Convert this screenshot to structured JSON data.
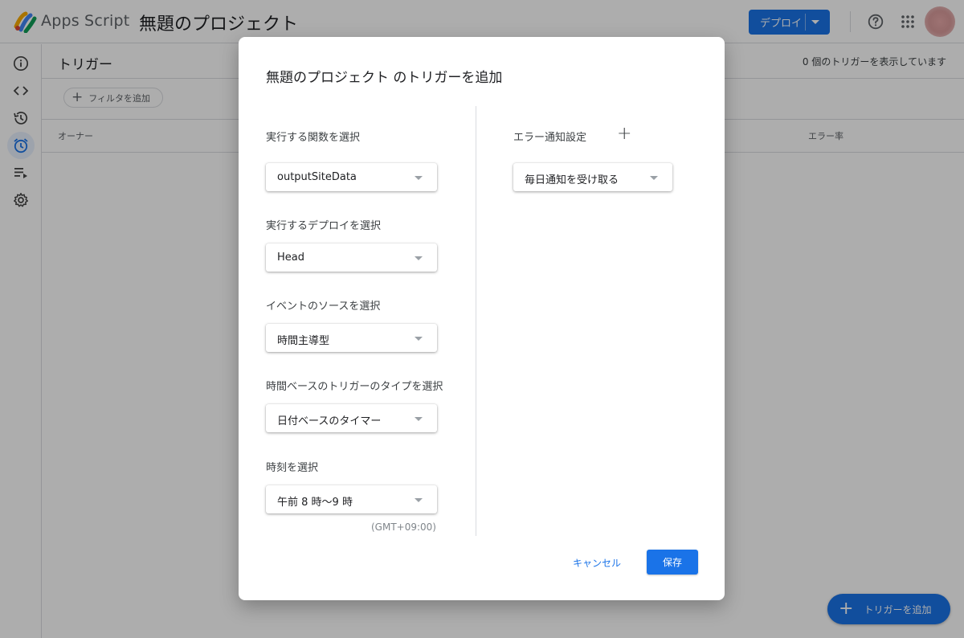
{
  "header": {
    "app_name": "Apps Script",
    "project_name": "無題のプロジェクト",
    "deploy_label": "デプロイ",
    "icons": [
      "help-icon",
      "apps-grid-icon",
      "avatar"
    ]
  },
  "sidebar": {
    "items": [
      {
        "icon": "info-icon",
        "label": "概要"
      },
      {
        "icon": "code-icon",
        "label": "エディタ"
      },
      {
        "icon": "history-icon",
        "label": "実行数"
      },
      {
        "icon": "alarm-clock-icon",
        "label": "トリガー",
        "active": true
      },
      {
        "icon": "executions-icon",
        "label": "実行"
      },
      {
        "icon": "gear-icon",
        "label": "プロジェクトの設定"
      }
    ]
  },
  "main": {
    "title": "トリガー",
    "count_text": "0 個のトリガーを表示しています",
    "filter_label": "フィルタを追加",
    "columns": {
      "owner": "オーナー",
      "error_rate": "エラー率"
    },
    "fab_label": "トリガーを追加"
  },
  "dialog": {
    "title": "無題のプロジェクト のトリガーを追加",
    "fields": [
      {
        "label": "実行する関数を選択",
        "value": "outputSiteData"
      },
      {
        "label": "実行するデプロイを選択",
        "value": "Head"
      },
      {
        "label": "イベントのソースを選択",
        "value": "時間主導型"
      },
      {
        "label": "時間ベースのトリガーのタイプを選択",
        "value": "日付ベースのタイマー"
      },
      {
        "label": "時刻を選択",
        "value": "午前 8 時〜9 時"
      }
    ],
    "timezone": "(GMT+09:00)",
    "error_notification": {
      "label": "エラー通知設定",
      "value": "毎日通知を受け取る"
    },
    "cancel_label": "キャンセル",
    "save_label": "保存"
  },
  "colors": {
    "accent": "#1a73e8",
    "scrim": "rgba(0,0,0,0.32)"
  }
}
